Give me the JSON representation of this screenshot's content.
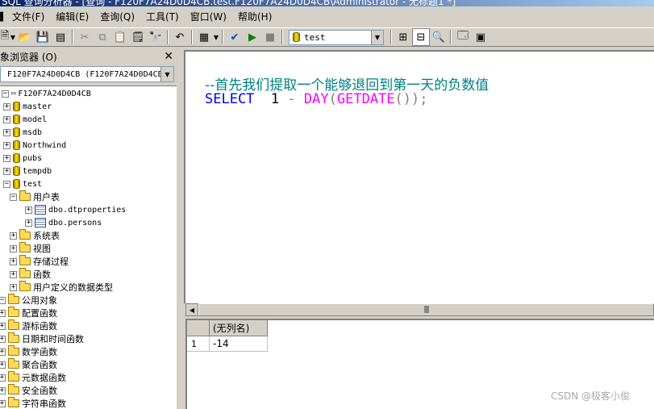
{
  "window": {
    "title": "SQL 查询分析器 - [查询 - F120F7A24D0D4CB.test.F120F7A24D0D4CB\\Administrator - 无标题1 *]"
  },
  "menu": [
    "文件(F)",
    "编辑(E)",
    "查询(Q)",
    "工具(T)",
    "窗口(W)",
    "帮助(H)"
  ],
  "toolbar": {
    "database_select": "test"
  },
  "object_browser": {
    "title": "象浏览器 (O)",
    "server_select": "F120F7A24D0D4CB (F120F7A24D0D4CB\\",
    "server": "F120F7A24D0D4CB",
    "databases": [
      "master",
      "model",
      "msdb",
      "Northwind",
      "pubs",
      "tempdb",
      "test"
    ],
    "test_children": {
      "user_tables": "用户表",
      "tables": [
        "dbo.dtproperties",
        "dbo.persons"
      ],
      "others": [
        "系统表",
        "视图",
        "存储过程",
        "函数",
        "用户定义的数据类型"
      ]
    },
    "common_objects": "公用对象",
    "common_children": [
      "配置函数",
      "游标函数",
      "日期和时间函数",
      "数学函数",
      "聚合函数",
      "元数据函数",
      "安全函数",
      "字符串函数"
    ]
  },
  "editor": {
    "comment": "--首先我们提取一个能够退回到第一天的负数值",
    "code": {
      "select": "SELECT",
      "num": "1",
      "minus": "-",
      "day": "DAY",
      "paren1": "(",
      "getdate": "GETDATE",
      "paren2": "())",
      "semicolon": ";"
    }
  },
  "results": {
    "column": "(无列名)",
    "row_number": "1",
    "value": "-14"
  },
  "watermark": "CSDN @极客小俊"
}
